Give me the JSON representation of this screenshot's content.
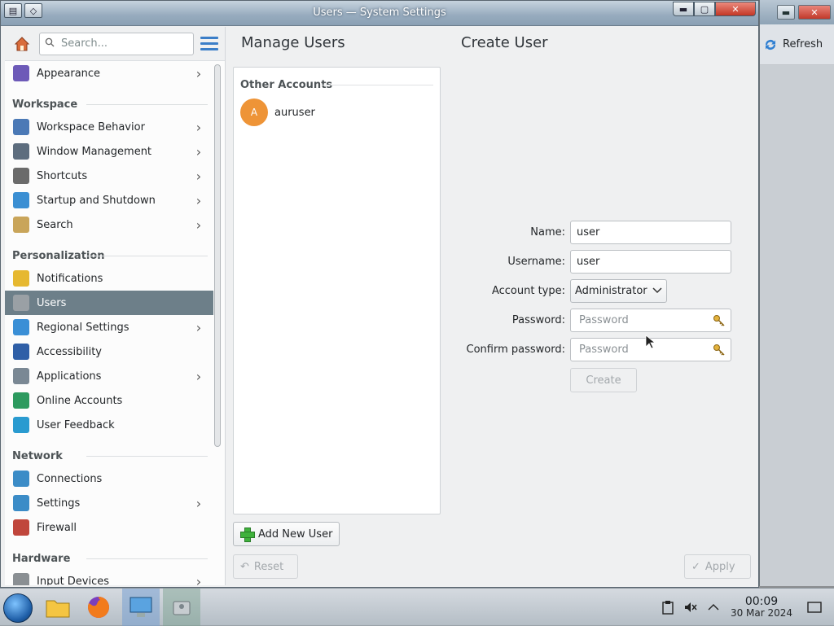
{
  "window": {
    "title": "Users — System Settings"
  },
  "background_window": {
    "refresh_label": "Refresh"
  },
  "sidebar": {
    "search_placeholder": "Search...",
    "items": [
      {
        "label": "Appearance",
        "icon": "appearance-icon",
        "chevron": true
      },
      {
        "category": "Workspace"
      },
      {
        "label": "Workspace Behavior",
        "icon": "workspace-behavior-icon",
        "chevron": true
      },
      {
        "label": "Window Management",
        "icon": "window-management-icon",
        "chevron": true
      },
      {
        "label": "Shortcuts",
        "icon": "shortcuts-icon",
        "chevron": true
      },
      {
        "label": "Startup and Shutdown",
        "icon": "startup-shutdown-icon",
        "chevron": true
      },
      {
        "label": "Search",
        "icon": "search-settings-icon",
        "chevron": true
      },
      {
        "category": "Personalization"
      },
      {
        "label": "Notifications",
        "icon": "bell-icon",
        "chevron": false
      },
      {
        "label": "Users",
        "icon": "users-icon",
        "chevron": false,
        "active": true
      },
      {
        "label": "Regional Settings",
        "icon": "globe-icon",
        "chevron": true
      },
      {
        "label": "Accessibility",
        "icon": "accessibility-icon",
        "chevron": false
      },
      {
        "label": "Applications",
        "icon": "applications-icon",
        "chevron": true
      },
      {
        "label": "Online Accounts",
        "icon": "online-accounts-icon",
        "chevron": false
      },
      {
        "label": "User Feedback",
        "icon": "user-feedback-icon",
        "chevron": false
      },
      {
        "category": "Network"
      },
      {
        "label": "Connections",
        "icon": "connections-icon",
        "chevron": false
      },
      {
        "label": "Settings",
        "icon": "network-settings-icon",
        "chevron": true
      },
      {
        "label": "Firewall",
        "icon": "firewall-icon",
        "chevron": false
      },
      {
        "category": "Hardware"
      },
      {
        "label": "Input Devices",
        "icon": "input-devices-icon",
        "chevron": true
      }
    ]
  },
  "main": {
    "manage_title": "Manage Users",
    "create_title": "Create User",
    "accounts_header": "Other Accounts",
    "accounts": [
      {
        "initial": "A",
        "name": "auruser"
      }
    ],
    "add_button": "Add New User",
    "reset_button": "Reset",
    "apply_button": "Apply"
  },
  "form": {
    "name_label": "Name:",
    "name_value": "user",
    "username_label": "Username:",
    "username_value": "user",
    "account_type_label": "Account type:",
    "account_type_value": "Administrator",
    "password_label": "Password:",
    "password_placeholder": "Password",
    "confirm_label": "Confirm password:",
    "confirm_placeholder": "Password",
    "create_button": "Create"
  },
  "taskbar": {
    "time": "00:09",
    "date": "30 Mar 2024"
  },
  "colors": {
    "active_item": "#6d7f89",
    "accent": "#3b7ec8",
    "avatar": "#ee9437"
  }
}
